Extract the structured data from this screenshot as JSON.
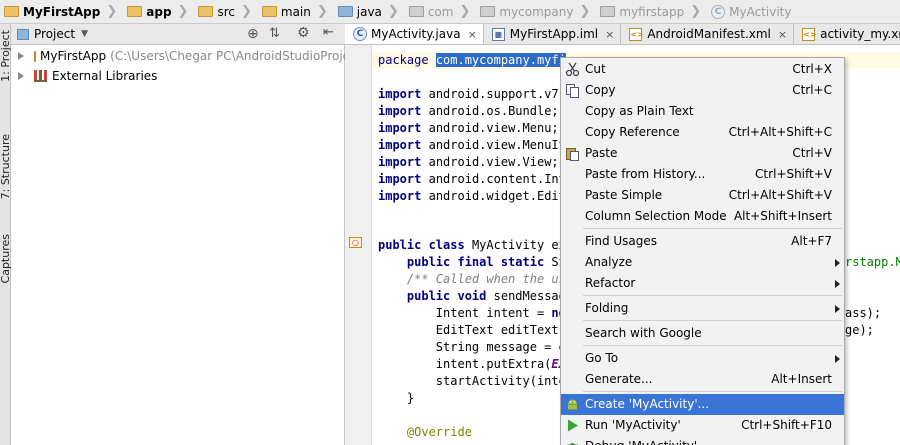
{
  "breadcrumb": [
    {
      "label": "MyFirstApp",
      "icon": "project-folder-icon",
      "style": "bold"
    },
    {
      "label": "app",
      "icon": "folder-icon",
      "style": "bold"
    },
    {
      "label": "src",
      "icon": "folder-icon",
      "style": "normal"
    },
    {
      "label": "main",
      "icon": "folder-icon",
      "style": "normal"
    },
    {
      "label": "java",
      "icon": "source-folder-icon",
      "style": "normal"
    },
    {
      "label": "com",
      "icon": "package-folder-icon",
      "style": "gray"
    },
    {
      "label": "mycompany",
      "icon": "package-folder-icon",
      "style": "gray"
    },
    {
      "label": "myfirstapp",
      "icon": "package-folder-icon",
      "style": "gray"
    },
    {
      "label": "MyActivity",
      "icon": "class-icon",
      "style": "gray"
    }
  ],
  "left_strip": {
    "project_tab": "1: Project",
    "structure_tab": "7: Structure",
    "captures_tab": "Captures"
  },
  "project_panel": {
    "view_selector": "Project",
    "tree": [
      {
        "label": "MyFirstApp",
        "detail": "(C:\\Users\\Chegar PC\\AndroidStudioProject",
        "icon": "project-folder-icon"
      },
      {
        "label": "External Libraries",
        "detail": "",
        "icon": "libraries-icon"
      }
    ]
  },
  "editor_tabs": [
    {
      "label": "MyActivity.java",
      "icon": "class-icon",
      "active": true
    },
    {
      "label": "MyFirstApp.iml",
      "icon": "iml-file-icon",
      "active": false
    },
    {
      "label": "AndroidManifest.xml",
      "icon": "xml-file-icon",
      "active": false
    },
    {
      "label": "activity_my.xml",
      "icon": "xml-file-icon",
      "active": false
    }
  ],
  "code": {
    "package_kw": "package",
    "package_sel": "com.mycompany.myfi",
    "imports": [
      "android.support.v7.",
      "android.os.Bundle;",
      "android.view.Menu;",
      "android.view.MenuIt",
      "android.view.View;",
      "android.content.Int",
      "android.widget.Edit"
    ],
    "import_kw": "import",
    "class_decl_kw": "public class",
    "class_decl_rest": "MyActivity ex",
    "field_kw": "public final static",
    "field_rest": "St",
    "comment": "/** Called when the us",
    "method_kw": "public void",
    "method_rest": "sendMessag",
    "line_intent_a": "Intent intent = ",
    "line_intent_kw": "ne",
    "line_edit": "EditText editText",
    "line_string": "String message = e",
    "line_putextra_a": "intent.putExtra(",
    "line_putextra_b": "EX",
    "line_start": "startActivity(inte",
    "close_brace": "}",
    "override": "@Override",
    "right_frag_1": "rstapp.ME",
    "right_frag_2": "ass);",
    "right_frag_3": "ge);"
  },
  "context_menu": {
    "groups": [
      [
        {
          "label": "Cut",
          "shortcut": "Ctrl+X",
          "icon": "cut-icon",
          "mn": "t"
        },
        {
          "label": "Copy",
          "shortcut": "Ctrl+C",
          "icon": "copy-icon",
          "mn": "C"
        },
        {
          "label": "Copy as Plain Text",
          "shortcut": "",
          "icon": ""
        },
        {
          "label": "Copy Reference",
          "shortcut": "Ctrl+Alt+Shift+C",
          "icon": ""
        },
        {
          "label": "Paste",
          "shortcut": "Ctrl+V",
          "icon": "paste-icon"
        },
        {
          "label": "Paste from History...",
          "shortcut": "Ctrl+Shift+V",
          "icon": ""
        },
        {
          "label": "Paste Simple",
          "shortcut": "Ctrl+Alt+Shift+V",
          "icon": ""
        },
        {
          "label": "Column Selection Mode",
          "shortcut": "Alt+Shift+Insert",
          "icon": ""
        }
      ],
      [
        {
          "label": "Find Usages",
          "shortcut": "Alt+F7",
          "icon": ""
        },
        {
          "label": "Analyze",
          "shortcut": "",
          "icon": "",
          "submenu": true
        },
        {
          "label": "Refactor",
          "shortcut": "",
          "icon": "",
          "submenu": true
        }
      ],
      [
        {
          "label": "Folding",
          "shortcut": "",
          "icon": "",
          "submenu": true
        }
      ],
      [
        {
          "label": "Search with Google",
          "shortcut": "",
          "icon": ""
        }
      ],
      [
        {
          "label": "Go To",
          "shortcut": "",
          "icon": "",
          "submenu": true
        },
        {
          "label": "Generate...",
          "shortcut": "Alt+Insert",
          "icon": ""
        }
      ],
      [
        {
          "label": "Create 'MyActivity'...",
          "shortcut": "",
          "icon": "android-icon",
          "highlighted": true
        },
        {
          "label": "Run 'MyActivity'",
          "shortcut": "Ctrl+Shift+F10",
          "icon": "run-icon"
        },
        {
          "label": "Debug 'MyActivity'",
          "shortcut": "",
          "icon": "debug-icon"
        }
      ]
    ]
  },
  "colors": {
    "selection": "#2d6bc8",
    "menu_highlight": "#3875d7",
    "keyword": "#000080",
    "comment": "#808080",
    "annotation": "#808000"
  }
}
